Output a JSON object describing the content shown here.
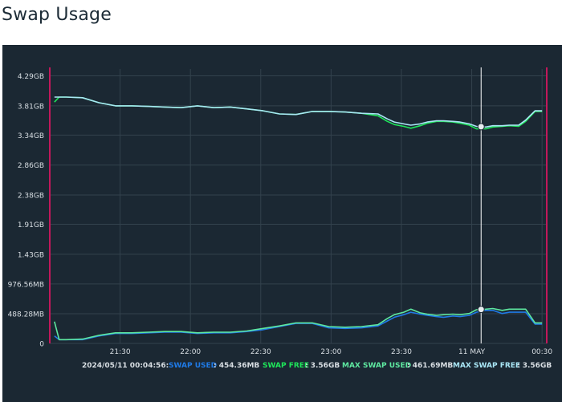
{
  "page": {
    "title": "Swap Usage"
  },
  "colors": {
    "panel_bg": "#1b2833",
    "grid": "#33424d",
    "axis_text": "#d8dee3",
    "swap_used": "#1f7ae6",
    "swap_free": "#1ee65a",
    "max_swap_used": "#5ee8a0",
    "max_swap_free": "#a9e6f5",
    "range_marker": "#c2185b",
    "cursor": "#ffffff"
  },
  "legend": {
    "timestamp": "2024/05/11 00:04:56:",
    "items": [
      {
        "label": "SWAP USED",
        "value": ": 454.36MB",
        "color": "#1f7ae6"
      },
      {
        "label": "SWAP FREE",
        "value": ": 3.56GB",
        "color": "#1ee65a"
      },
      {
        "label": "MAX SWAP USED",
        "value": ": 461.69MB",
        "color": "#5ee8a0"
      },
      {
        "label": "MAX SWAP FREE",
        "value": ": 3.56GB",
        "color": "#a9e6f5"
      }
    ]
  },
  "chart_data": {
    "type": "line",
    "title": "Swap Usage",
    "xlabel": "",
    "ylabel": "",
    "x_ticks": [
      "21:30",
      "22:00",
      "22:30",
      "23:00",
      "23:30",
      "11 MAY",
      "00:30"
    ],
    "y_ticks": [
      "0",
      "488.28MB",
      "976.56MB",
      "1.43GB",
      "1.91GB",
      "2.38GB",
      "2.86GB",
      "3.34GB",
      "3.81GB",
      "4.29GB"
    ],
    "ylim": [
      0,
      4.4
    ],
    "y_unit": "GB",
    "x_minutes_from_2100": [
      2,
      4,
      7,
      14,
      21,
      28,
      35,
      42,
      49,
      56,
      63,
      70,
      77,
      84,
      91,
      98,
      105,
      112,
      119,
      126,
      133,
      140,
      144,
      147,
      151,
      154,
      158,
      161,
      165,
      168,
      172,
      175,
      179,
      182,
      186,
      189,
      193,
      196,
      200,
      203,
      207,
      210
    ],
    "series": [
      {
        "name": "SWAP USED",
        "color": "#1f7ae6",
        "values": [
          0.12,
          0.06,
          0.06,
          0.06,
          0.12,
          0.16,
          0.16,
          0.17,
          0.18,
          0.18,
          0.16,
          0.17,
          0.17,
          0.19,
          0.22,
          0.27,
          0.32,
          0.32,
          0.25,
          0.24,
          0.25,
          0.28,
          0.36,
          0.42,
          0.46,
          0.5,
          0.47,
          0.45,
          0.43,
          0.42,
          0.44,
          0.43,
          0.45,
          0.5,
          0.53,
          0.53,
          0.48,
          0.5,
          0.5,
          0.5,
          0.31,
          0.31
        ]
      },
      {
        "name": "SWAP FREE",
        "color": "#1ee65a",
        "values": [
          3.87,
          3.95,
          3.95,
          3.94,
          3.86,
          3.81,
          3.81,
          3.8,
          3.79,
          3.78,
          3.81,
          3.78,
          3.79,
          3.76,
          3.73,
          3.68,
          3.67,
          3.72,
          3.72,
          3.71,
          3.69,
          3.65,
          3.56,
          3.51,
          3.48,
          3.45,
          3.49,
          3.53,
          3.56,
          3.56,
          3.55,
          3.53,
          3.5,
          3.44,
          3.44,
          3.47,
          3.48,
          3.49,
          3.48,
          3.56,
          3.72,
          3.72
        ]
      },
      {
        "name": "MAX SWAP USED",
        "color": "#5ee8a0",
        "values": [
          0.35,
          0.06,
          0.06,
          0.07,
          0.13,
          0.17,
          0.17,
          0.18,
          0.19,
          0.19,
          0.17,
          0.18,
          0.18,
          0.2,
          0.24,
          0.28,
          0.33,
          0.33,
          0.27,
          0.26,
          0.27,
          0.3,
          0.4,
          0.46,
          0.5,
          0.55,
          0.49,
          0.47,
          0.45,
          0.46,
          0.47,
          0.46,
          0.48,
          0.54,
          0.55,
          0.56,
          0.53,
          0.55,
          0.55,
          0.55,
          0.33,
          0.33
        ]
      },
      {
        "name": "MAX SWAP FREE",
        "color": "#a9e6f5",
        "values": [
          3.95,
          3.95,
          3.95,
          3.94,
          3.86,
          3.81,
          3.81,
          3.8,
          3.79,
          3.78,
          3.81,
          3.78,
          3.79,
          3.76,
          3.73,
          3.68,
          3.67,
          3.72,
          3.72,
          3.71,
          3.69,
          3.68,
          3.6,
          3.55,
          3.52,
          3.5,
          3.52,
          3.55,
          3.57,
          3.57,
          3.56,
          3.55,
          3.52,
          3.48,
          3.47,
          3.49,
          3.49,
          3.5,
          3.5,
          3.58,
          3.73,
          3.73
        ]
      }
    ],
    "cursor_minutes_from_2100": 184,
    "grid": true,
    "legend_placement": "bottom"
  }
}
